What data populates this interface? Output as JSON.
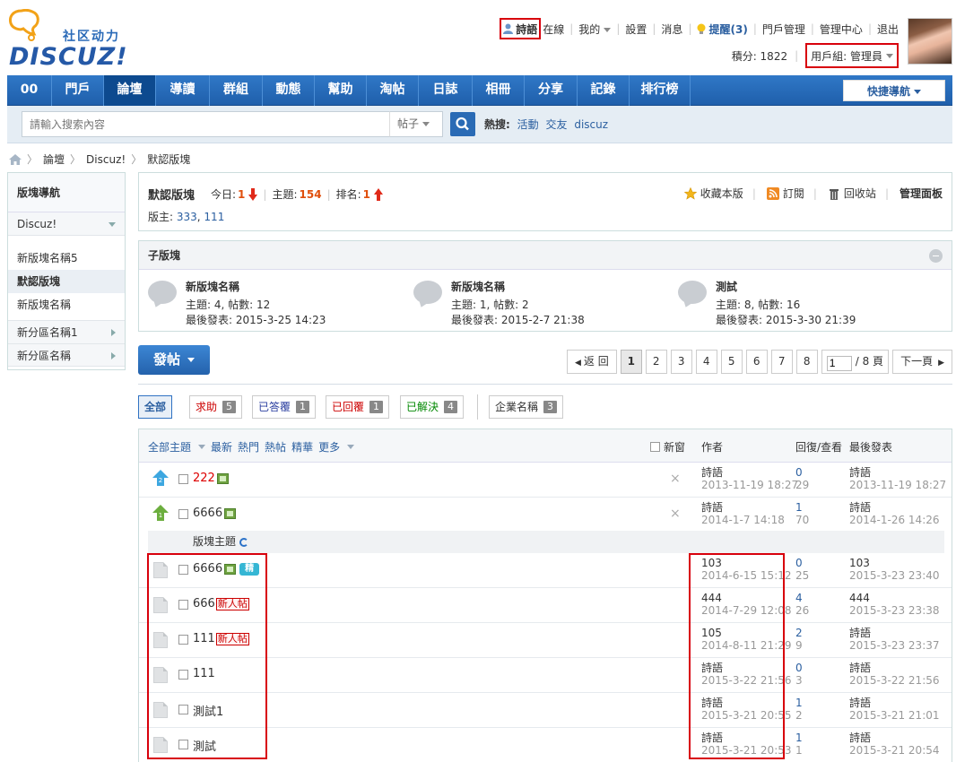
{
  "brand": {
    "slogan": "社区动力",
    "name": "DISCUZ!"
  },
  "topbar": {
    "username": "詩語",
    "online": "在線",
    "mine": "我的",
    "settings": "設置",
    "messages": "消息",
    "remind": "提醒(3)",
    "portal_admin": "門戶管理",
    "admin_center": "管理中心",
    "logout": "退出",
    "credits": "積分: 1822",
    "usergroup": "用戶組: 管理員"
  },
  "nav": {
    "items": [
      "00",
      "門戶",
      "論壇",
      "導讀",
      "群組",
      "動態",
      "幫助",
      "淘帖",
      "日誌",
      "相冊",
      "分享",
      "記錄",
      "排行榜"
    ],
    "quicknav": "快捷導航"
  },
  "search": {
    "placeholder": "請輸入搜索內容",
    "type": "帖子",
    "hot_label": "熱搜:",
    "hot": [
      "活動",
      "交友",
      "discuz"
    ]
  },
  "breadcrumb": [
    "論壇",
    "Discuz!",
    "默認版塊"
  ],
  "sidebar": {
    "title": "版塊導航",
    "group": "Discuz!",
    "items": [
      "新版塊名稱5",
      "默認版塊",
      "新版塊名稱"
    ],
    "subgroups": [
      "新分區名稱1",
      "新分區名稱"
    ]
  },
  "forum": {
    "name": "默認版塊",
    "today_label": "今日:",
    "today": "1",
    "topics_label": "主題:",
    "topics": "154",
    "rank_label": "排名:",
    "rank": "1",
    "moderators_label": "版主:",
    "moderators": [
      "333",
      "111"
    ],
    "actions": {
      "fav": "收藏本版",
      "rss": "訂閱",
      "recycle": "回收站",
      "panel": "管理面板"
    }
  },
  "subforums": {
    "title": "子版塊",
    "items": [
      {
        "name": "新版塊名稱",
        "stats": "主題: 4, 帖數: 12",
        "last": "最後發表: 2015-3-25 14:23"
      },
      {
        "name": "新版塊名稱",
        "stats": "主題: 1, 帖數: 2",
        "last": "最後發表: 2015-2-7 21:38"
      },
      {
        "name": "測試",
        "stats": "主題: 8, 帖數: 16",
        "last": "最後發表: 2015-3-30 21:39"
      }
    ]
  },
  "post_button": "發帖",
  "pager": {
    "back": "返 回",
    "pages": [
      "1",
      "2",
      "3",
      "4",
      "5",
      "6",
      "7",
      "8"
    ],
    "current": "1",
    "total": "/ 8 頁",
    "next": "下一頁"
  },
  "types": [
    {
      "label": "全部",
      "count": ""
    },
    {
      "label": "求助",
      "count": "5",
      "color": "#c00"
    },
    {
      "label": "已答覆",
      "count": "1",
      "color": "#2b3fa0"
    },
    {
      "label": "已回覆",
      "count": "1",
      "color": "#c00"
    },
    {
      "label": "已解決",
      "count": "4",
      "color": "#080"
    },
    {
      "label": "企業名稱",
      "count": "3",
      "color": "#333"
    }
  ],
  "thread_header": {
    "filters": [
      "全部主題",
      "最新",
      "熱門",
      "熱帖",
      "精華",
      "更多"
    ],
    "new_window": "新窗",
    "author": "作者",
    "replies": "回復/查看",
    "last": "最後發表"
  },
  "section_label": "版塊主題",
  "threads": [
    {
      "title": "222",
      "red": true,
      "author": "詩語",
      "adate": "2013-11-19 18:27",
      "replies": "0",
      "views": "29",
      "lauthor": "詩語",
      "ldate": "2013-11-19 18:27",
      "sticky": "2"
    },
    {
      "title": "6666",
      "red": false,
      "author": "詩語",
      "adate": "2014-1-7 14:18",
      "replies": "1",
      "views": "70",
      "lauthor": "詩語",
      "ldate": "2014-1-26 14:26",
      "sticky": "1"
    },
    {
      "title": "6666",
      "author": "103",
      "adate": "2014-6-15 15:12",
      "replies": "0",
      "views": "25",
      "lauthor": "103",
      "ldate": "2015-3-23 23:40",
      "badge": "精"
    },
    {
      "title": "666",
      "author": "444",
      "adate": "2014-7-29 12:08",
      "replies": "4",
      "views": "26",
      "lauthor": "444",
      "ldate": "2015-3-23 23:38",
      "new": "新人帖"
    },
    {
      "title": "111",
      "author": "105",
      "adate": "2014-8-11 21:29",
      "replies": "2",
      "views": "9",
      "lauthor": "詩語",
      "ldate": "2015-3-23 23:37",
      "new": "新人帖"
    },
    {
      "title": "111",
      "author": "詩語",
      "adate": "2015-3-22 21:56",
      "replies": "0",
      "views": "3",
      "lauthor": "詩語",
      "ldate": "2015-3-22 21:56"
    },
    {
      "title": "測試1",
      "author": "詩語",
      "adate": "2015-3-21 20:55",
      "replies": "1",
      "views": "2",
      "lauthor": "詩語",
      "ldate": "2015-3-21 21:01"
    },
    {
      "title": "測試",
      "author": "詩語",
      "adate": "2015-3-21 20:53",
      "replies": "1",
      "views": "1",
      "lauthor": "詩語",
      "ldate": "2015-3-21 20:54"
    }
  ]
}
